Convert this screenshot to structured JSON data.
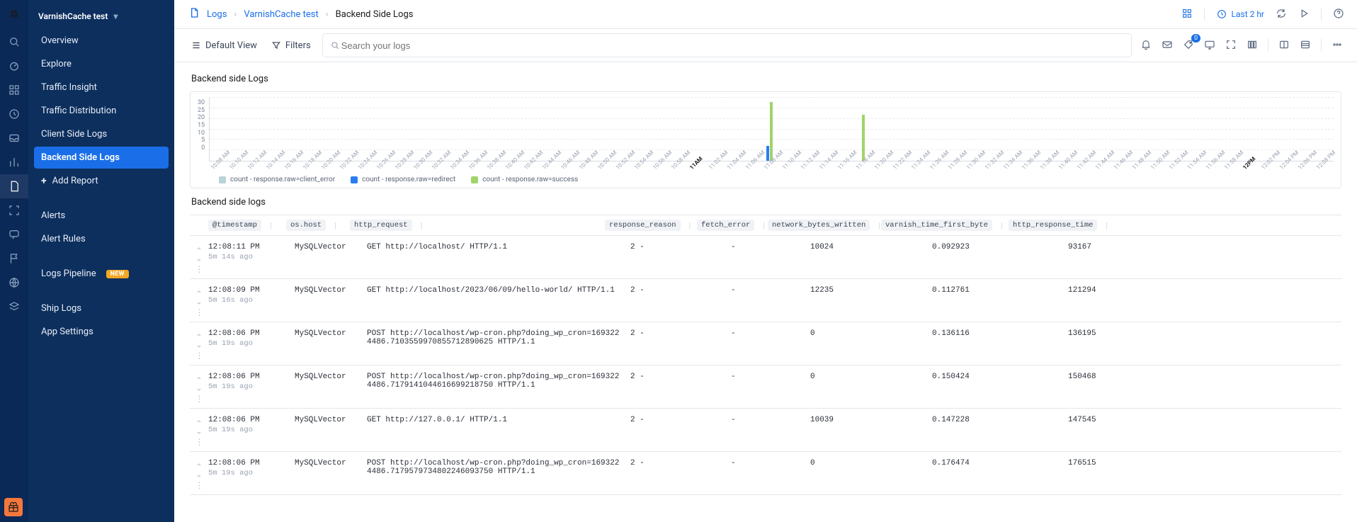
{
  "workspace": {
    "name": "VarnishCache test"
  },
  "rail_icons": [
    "search-icon",
    "dashboard-icon",
    "apps-icon",
    "clock-icon",
    "inbox-icon",
    "bar-chart-icon",
    "document-icon",
    "scan-icon",
    "chat-icon",
    "flag-icon",
    "globe-icon",
    "stack-icon"
  ],
  "rail_active_index": 6,
  "sidebar": {
    "groups": [
      [
        "Overview",
        "Explore",
        "Traffic Insight",
        "Traffic Distribution",
        "Client Side Logs",
        "Backend Side Logs"
      ],
      [
        "Alerts",
        "Alert Rules"
      ],
      [
        "Logs Pipeline"
      ],
      [
        "Ship Logs",
        "App Settings"
      ]
    ],
    "active": "Backend Side Logs",
    "add_report": "Add Report",
    "logs_pipeline_badge": "NEW"
  },
  "breadcrumbs": {
    "root": "Logs",
    "project": "VarnishCache test",
    "page": "Backend Side Logs"
  },
  "topbar": {
    "time_range": "Last 2 hr"
  },
  "toolbar": {
    "default_view": "Default View",
    "filters": "Filters",
    "search_placeholder": "Search your logs",
    "tag_count": "0"
  },
  "chart_panel_title": "Backend side Logs",
  "table_panel_title": "Backend side logs",
  "chart_data": {
    "type": "bar",
    "title": "Backend side Logs",
    "ylabel": "count",
    "ylim": [
      0,
      30
    ],
    "yticks": [
      0,
      5,
      10,
      15,
      20,
      25,
      30
    ],
    "x_major": [
      "11AM",
      "12PM"
    ],
    "categories": [
      "10:08 AM",
      "10:10 AM",
      "10:12 AM",
      "10:14 AM",
      "10:16 AM",
      "10:18 AM",
      "10:20 AM",
      "10:22 AM",
      "10:24 AM",
      "10:26 AM",
      "10:28 AM",
      "10:30 AM",
      "10:32 AM",
      "10:34 AM",
      "10:36 AM",
      "10:38 AM",
      "10:40 AM",
      "10:42 AM",
      "10:44 AM",
      "10:46 AM",
      "10:48 AM",
      "10:50 AM",
      "10:52 AM",
      "10:54 AM",
      "10:56 AM",
      "10:58 AM",
      "11AM",
      "11:02 AM",
      "11:04 AM",
      "11:06 AM",
      "11:08 AM",
      "11:10 AM",
      "11:12 AM",
      "11:14 AM",
      "11:16 AM",
      "11:18 AM",
      "11:20 AM",
      "11:22 AM",
      "11:24 AM",
      "11:26 AM",
      "11:28 AM",
      "11:30 AM",
      "11:32 AM",
      "11:34 AM",
      "11:36 AM",
      "11:38 AM",
      "11:40 AM",
      "11:42 AM",
      "11:44 AM",
      "11:46 AM",
      "11:48 AM",
      "11:50 AM",
      "11:52 AM",
      "11:54 AM",
      "11:56 AM",
      "11:58 AM",
      "12PM",
      "12:02 PM",
      "12:04 PM",
      "12:06 PM",
      "12:08 PM"
    ],
    "series": [
      {
        "name": "count - response.raw=client_error",
        "color": "#b7d4d8",
        "values_sparse": {}
      },
      {
        "name": "count - response.raw=redirect",
        "color": "#2b7ef0",
        "values_sparse": {
          "11:08 AM": 7
        }
      },
      {
        "name": "count - response.raw=success",
        "color": "#a0d46a",
        "values_sparse": {
          "11:08 AM": 28,
          "11:18 AM": 22
        }
      }
    ]
  },
  "columns": [
    "@timestamp",
    "os.host",
    "http_request",
    "response_reason",
    "fetch_error",
    "network_bytes_written",
    "varnish_time_first_byte",
    "http_response_time"
  ],
  "rows": [
    {
      "ts": "12:08:11 PM",
      "age": "5m 14s ago",
      "host": "MySQLVector",
      "req": "GET http://localhost/ HTTP/1.1",
      "reason": "2 -",
      "ferr": "-",
      "nbw": "10024",
      "vtfb": "0.092923",
      "hrt": "93167"
    },
    {
      "ts": "12:08:09 PM",
      "age": "5m 16s ago",
      "host": "MySQLVector",
      "req": "GET http://localhost/2023/06/09/hello-world/ HTTP/1.1",
      "reason": "2 -",
      "ferr": "-",
      "nbw": "12235",
      "vtfb": "0.112761",
      "hrt": "121294"
    },
    {
      "ts": "12:08:06 PM",
      "age": "5m 19s ago",
      "host": "MySQLVector",
      "req": "POST http://localhost/wp-cron.php?doing_wp_cron=1693224486.7103559970855712890625 HTTP/1.1",
      "reason": "2 -",
      "ferr": "-",
      "nbw": "0",
      "vtfb": "0.136116",
      "hrt": "136195"
    },
    {
      "ts": "12:08:06 PM",
      "age": "5m 19s ago",
      "host": "MySQLVector",
      "req": "POST http://localhost/wp-cron.php?doing_wp_cron=1693224486.7179141044616699218750 HTTP/1.1",
      "reason": "2 -",
      "ferr": "-",
      "nbw": "0",
      "vtfb": "0.150424",
      "hrt": "150468"
    },
    {
      "ts": "12:08:06 PM",
      "age": "5m 19s ago",
      "host": "MySQLVector",
      "req": "GET http://127.0.0.1/ HTTP/1.1",
      "reason": "2 -",
      "ferr": "-",
      "nbw": "10039",
      "vtfb": "0.147228",
      "hrt": "147545"
    },
    {
      "ts": "12:08:06 PM",
      "age": "5m 19s ago",
      "host": "MySQLVector",
      "req": "POST http://localhost/wp-cron.php?doing_wp_cron=1693224486.7179579734802246093750 HTTP/1.1",
      "reason": "2 -",
      "ferr": "-",
      "nbw": "0",
      "vtfb": "0.176474",
      "hrt": "176515"
    }
  ]
}
